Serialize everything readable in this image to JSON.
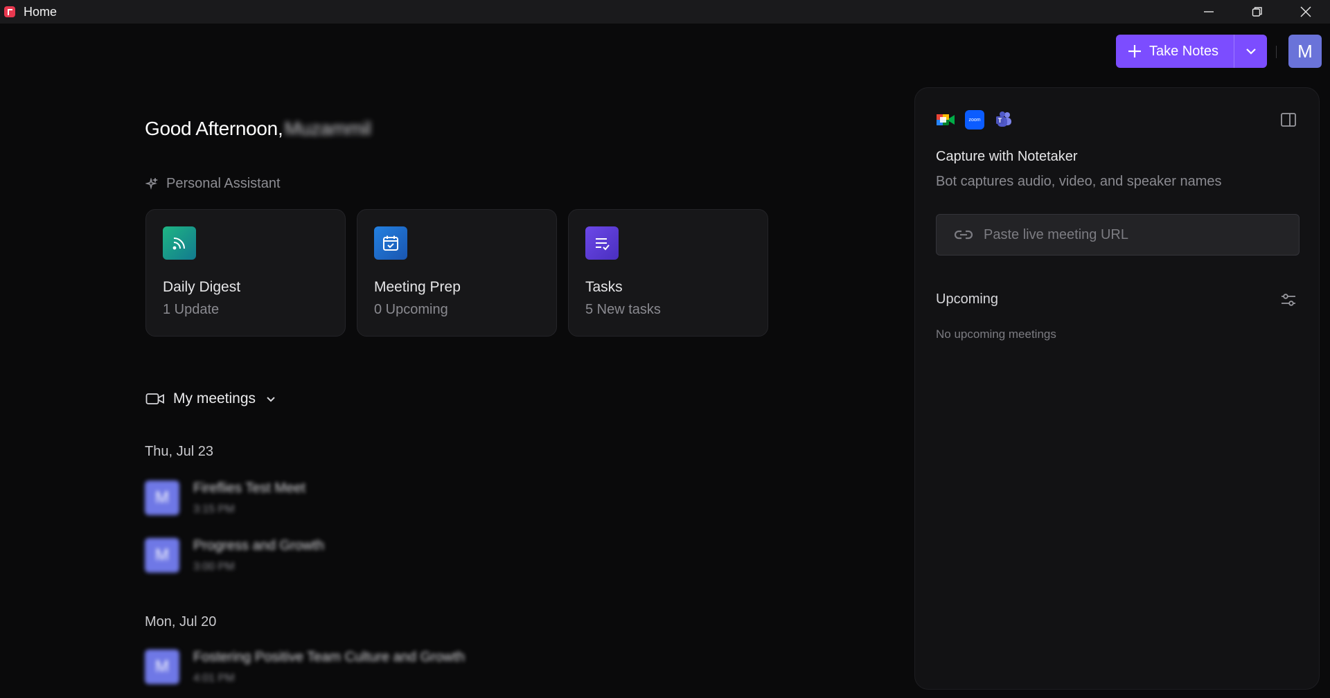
{
  "window": {
    "title": "Home"
  },
  "header": {
    "take_notes_label": "Take Notes",
    "avatar_initial": "M"
  },
  "greeting": {
    "text": "Good Afternoon,",
    "name": "Muzammil"
  },
  "assistant": {
    "heading": "Personal Assistant",
    "cards": [
      {
        "title": "Daily Digest",
        "subtitle": "1 Update",
        "icon": "rss-icon",
        "color": "#1aa37a"
      },
      {
        "title": "Meeting Prep",
        "subtitle": "0 Upcoming",
        "icon": "calendar-check-icon",
        "color": "#1f6fd1"
      },
      {
        "title": "Tasks",
        "subtitle": "5 New tasks",
        "icon": "tasks-icon",
        "color": "#5b3fd6"
      }
    ]
  },
  "meetings": {
    "heading": "My meetings",
    "groups": [
      {
        "date": "Thu, Jul 23",
        "items": [
          {
            "initial": "M",
            "title": "Fireflies Test Meet",
            "time": "3:15 PM"
          },
          {
            "initial": "M",
            "title": "Progress and Growth",
            "time": "3:00 PM"
          }
        ]
      },
      {
        "date": "Mon, Jul 20",
        "items": [
          {
            "initial": "M",
            "title": "Fostering Positive Team Culture and Growth",
            "time": "4:01 PM"
          }
        ]
      }
    ]
  },
  "panel": {
    "capture_title": "Capture with Notetaker",
    "capture_subtitle": "Bot captures audio, video, and speaker names",
    "url_placeholder": "Paste live meeting URL",
    "zoom_label": "zoom",
    "upcoming_label": "Upcoming",
    "no_upcoming": "No upcoming meetings"
  }
}
